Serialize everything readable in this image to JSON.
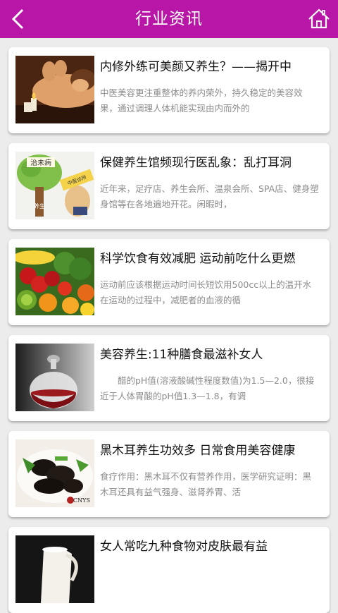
{
  "header": {
    "title": "行业资讯",
    "back_icon": "back-chevron-icon",
    "home_icon": "home-icon",
    "bar_color": "#b716a6"
  },
  "articles": [
    {
      "title": "内修外练可美颜又养生？——揭开中",
      "summary": "中医美容更注重整体的养内荣外，持久稳定的美容效果，通过调理人体机能实现由内而外的",
      "thumbnail": "spa-massage-image"
    },
    {
      "title": "保健养生馆频现行医乱象：乱打耳洞",
      "summary": "近年来，足疗店、养生会所、温泉会所、SPA店、健身塑身馆等在各地遍地开花。闲暇时，",
      "thumbnail": "cartoon-tree-image",
      "thumbnail_text": [
        "治未病",
        "养生",
        "中医诊所"
      ]
    },
    {
      "title": "科学饮食有效减肥 运动前吃什么更燃",
      "summary": "运动前应该根据运动时间长短饮用500cc以上的温开水在运动的过程中，减肥者的血液的循",
      "thumbnail": "fruit-vegetables-image"
    },
    {
      "title": "美容养生:11种膳食最滋补女人",
      "summary": "　　醋的pH值(溶液酸碱性程度数值)为1.5—2.0，很接近于人体胃酸的pH值1.3—1.8，有调",
      "thumbnail": "vinegar-bottle-image"
    },
    {
      "title": "黑木耳养生功效多 日常食用美容健康",
      "summary": "食疗作用：黑木耳不仅有营养作用，医学研究证明：黑木耳还具有益气强身、滋肾养胃、活",
      "thumbnail": "black-fungus-dish-image",
      "thumbnail_text": "CNYS"
    },
    {
      "title": "女人常吃九种食物对皮肤最有益",
      "summary": "",
      "thumbnail": "milk-pitcher-image"
    }
  ]
}
